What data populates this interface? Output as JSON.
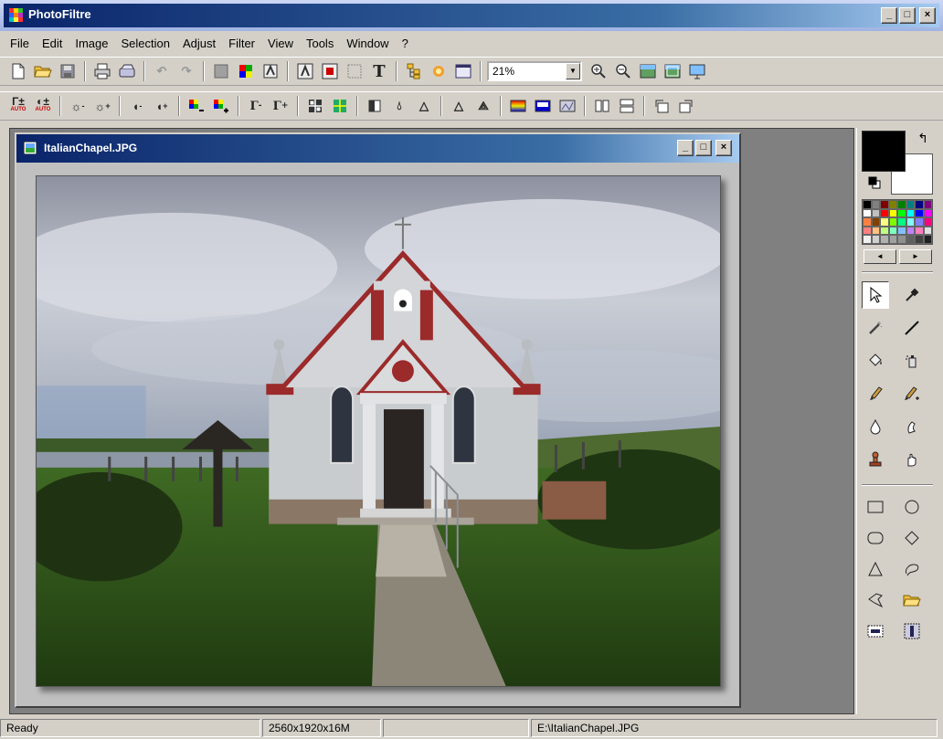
{
  "window": {
    "title": "PhotoFiltre",
    "controls": {
      "minimize": "_",
      "maximize": "□",
      "close": "×"
    }
  },
  "menu": [
    "File",
    "Edit",
    "Image",
    "Selection",
    "Adjust",
    "Filter",
    "View",
    "Tools",
    "Window",
    "?"
  ],
  "toolbar1": {
    "zoom_value": "21%",
    "icons": [
      "new-file-icon",
      "open-folder-icon",
      "save-icon",
      "print-icon",
      "scan-icon",
      "undo-icon",
      "redo-icon",
      "fill-icon",
      "color-grid-icon",
      "auto-icon",
      "image-size-icon",
      "canvas-size-icon",
      "crop-icon",
      "text-icon",
      "explorer-icon",
      "plugin-icon",
      "thumbnail-icon",
      "zoom-in-icon",
      "zoom-out-icon",
      "fit-icon",
      "actual-size-icon",
      "fullscreen-icon"
    ]
  },
  "toolbar2": {
    "labels": {
      "auto_levels": "Γ±",
      "auto_contrast": "◐±",
      "auto_sub": "AUTO"
    }
  },
  "document": {
    "name": "ItalianChapel.JPG",
    "controls": {
      "minimize": "_",
      "maximize": "□",
      "close": "×"
    }
  },
  "colors": {
    "foreground": "#000000",
    "background": "#ffffff",
    "palette": [
      "#000000",
      "#808080",
      "#800000",
      "#808000",
      "#008000",
      "#008080",
      "#000080",
      "#800080",
      "#ffffff",
      "#c0c0c0",
      "#ff0000",
      "#ffff00",
      "#00ff00",
      "#00ffff",
      "#0000ff",
      "#ff00ff",
      "#ff8040",
      "#804000",
      "#ffff80",
      "#80ff00",
      "#00ff80",
      "#80ffff",
      "#8080ff",
      "#ff0080",
      "#ff8080",
      "#ffc080",
      "#c0ff80",
      "#80ffc0",
      "#80c0ff",
      "#c080ff",
      "#ff80c0",
      "#e0e0e0",
      "#f0f0f0",
      "#d0d0d0",
      "#b0b0b0",
      "#a0a0a0",
      "#909090",
      "#606060",
      "#404040",
      "#202020"
    ]
  },
  "tools": [
    "selection-arrow-icon",
    "pipette-icon",
    "magic-wand-icon",
    "line-icon",
    "paint-bucket-icon",
    "spray-icon",
    "brush-icon",
    "advanced-brush-icon",
    "blur-drop-icon",
    "smudge-finger-icon",
    "clone-stamp-icon",
    "hand-icon",
    "rectangle-icon",
    "ellipse-icon",
    "rounded-rect-icon",
    "diamond-icon",
    "triangle-icon",
    "lasso-icon",
    "polygon-icon",
    "open-shape-icon",
    "text-select-icon",
    "invert-select-icon"
  ],
  "status": {
    "state": "Ready",
    "dimensions": "2560x1920x16M",
    "path": "E:\\ItalianChapel.JPG"
  }
}
